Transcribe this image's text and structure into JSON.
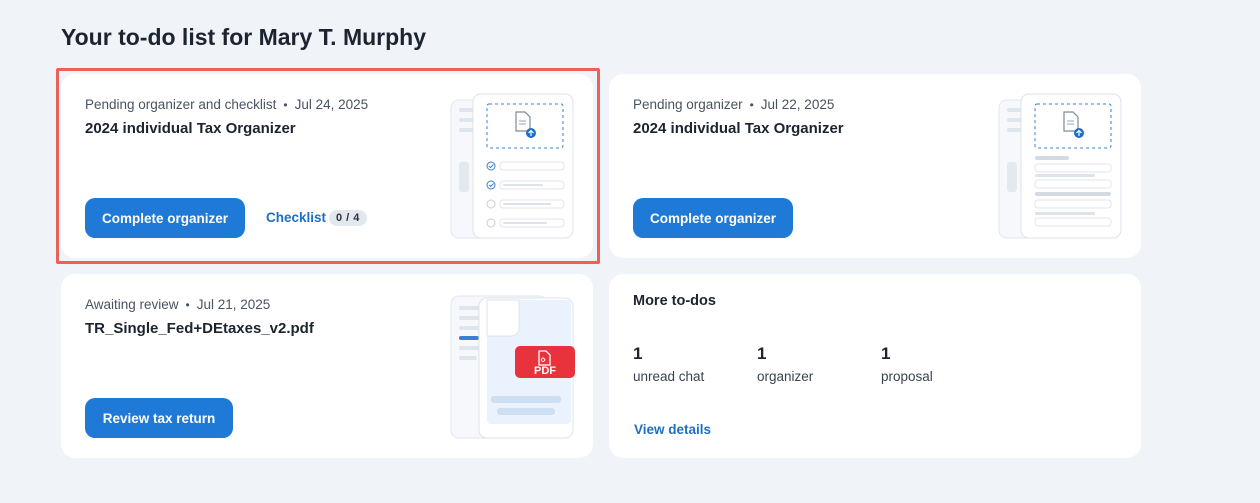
{
  "page": {
    "title": "Your to-do list for Mary T. Murphy"
  },
  "cards": [
    {
      "status": "Pending organizer and checklist",
      "date": "Jul 24, 2025",
      "title": "2024 individual Tax Organizer",
      "button": "Complete organizer",
      "link": "Checklist",
      "badge": "0 / 4"
    },
    {
      "status": "Pending organizer",
      "date": "Jul 22, 2025",
      "title": "2024 individual Tax Organizer",
      "button": "Complete organizer"
    },
    {
      "status": "Awaiting review",
      "date": "Jul 21, 2025",
      "title": "TR_Single_Fed+DEtaxes_v2.pdf",
      "button": "Review tax return",
      "illustration_label": "PDF"
    }
  ],
  "more_todos": {
    "title": "More to-dos",
    "stats": [
      {
        "count": "1",
        "label": "unread chat"
      },
      {
        "count": "1",
        "label": "organizer"
      },
      {
        "count": "1",
        "label": "proposal"
      }
    ],
    "link": "View details"
  },
  "colors": {
    "accent": "#1e7ad6",
    "highlight_border": "#e8625a",
    "pdf_red": "#e8323c",
    "background": "#f0f3f8"
  }
}
